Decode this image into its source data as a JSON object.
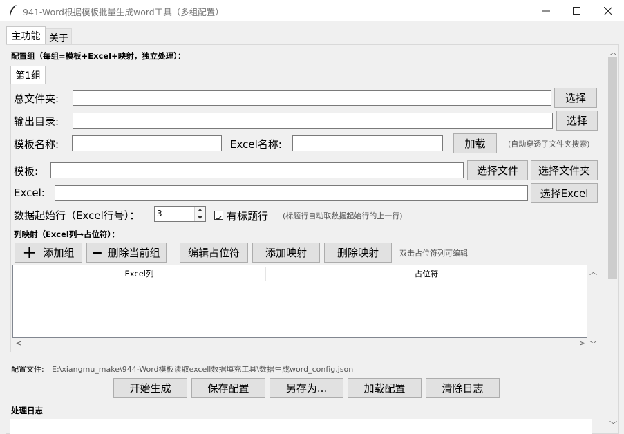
{
  "window": {
    "title": "941-Word根据模板批量生成word工具（多组配置）",
    "minimize_icon": "minimize-icon",
    "maximize_icon": "maximize-icon",
    "close_icon": "close-icon"
  },
  "tabs": {
    "main": "主功能",
    "about": "关于"
  },
  "config_groups_label": "配置组（每组=模板+Excel+映射，独立处理）：",
  "group_tab": "第1组",
  "fields": {
    "root_folder_label": "总文件夹:",
    "root_folder_value": "",
    "root_folder_button": "选择",
    "output_dir_label": "输出目录:",
    "output_dir_value": "",
    "output_dir_button": "选择",
    "template_name_label": "模板名称:",
    "template_name_value": "",
    "excel_name_label": "Excel名称:",
    "excel_name_value": "",
    "load_button": "加载",
    "auto_search_hint": "(自动穿透子文件夹搜索)",
    "template_label": "模板:",
    "template_value": "",
    "select_file_button": "选择文件",
    "select_folder_button": "选择文件夹",
    "excel_label": "Excel:",
    "excel_value": "",
    "select_excel_button": "选择Excel",
    "start_row_label": "数据起始行（Excel行号）：",
    "start_row_value": "3",
    "has_header_label": "有标题行",
    "has_header_checked": true,
    "header_hint": "(标题行自动取数据起始行的上一行)"
  },
  "mapping": {
    "label": "列映射（Excel列→占位符）：",
    "add_group_button": "添加组",
    "delete_group_button": "删除当前组",
    "edit_placeholder_button": "编辑占位符",
    "add_mapping_button": "添加映射",
    "delete_mapping_button": "删除映射",
    "edit_hint": "双击占位符列可编辑",
    "columns": [
      "Excel列",
      "占位符"
    ],
    "rows": []
  },
  "config_file": {
    "label": "配置文件:",
    "path": "E:\\xiangmu_make\\944-Word模板读取excell数据填充工具\\数据生成word_config.json"
  },
  "actions": {
    "start_button": "开始生成",
    "save_config_button": "保存配置",
    "save_as_button": "另存为...",
    "load_config_button": "加载配置",
    "clear_log_button": "清除日志"
  },
  "log": {
    "label": "处理日志"
  }
}
